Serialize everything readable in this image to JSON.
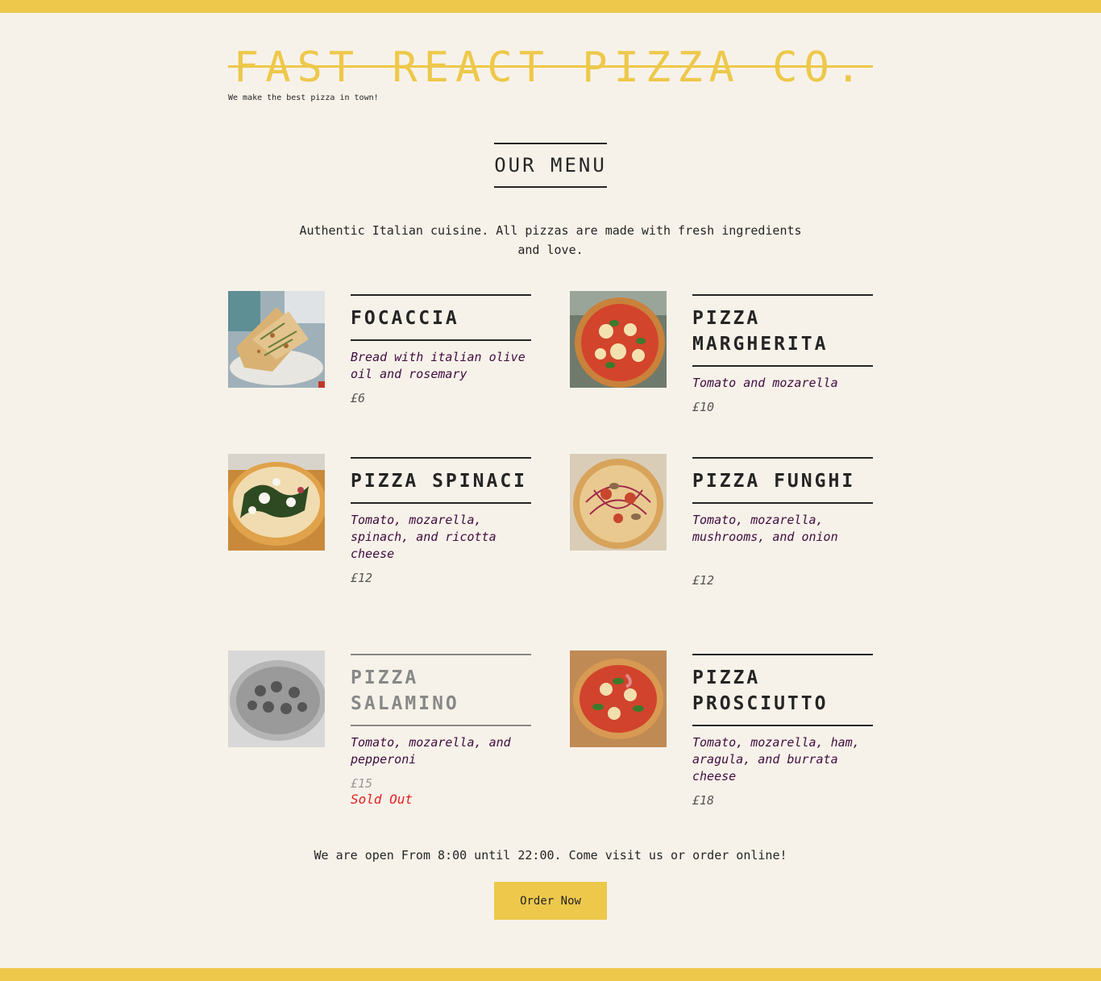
{
  "header": {
    "title": "FAST REACT PIZZA CO.",
    "tagline": "We make the best pizza in town!"
  },
  "menu": {
    "heading": "OUR MENU",
    "intro": "Authentic Italian cuisine. All pizzas are made with fresh ingredients and love.",
    "items": [
      {
        "name": "FOCACCIA",
        "description": "Bread with italian olive oil and rosemary",
        "price": "£6",
        "sold_out": false,
        "image": "focaccia-photo"
      },
      {
        "name": "PIZZA MARGHERITA",
        "description": "Tomato and mozarella",
        "price": "£10",
        "sold_out": false,
        "image": "margherita-photo"
      },
      {
        "name": "PIZZA SPINACI",
        "description": "Tomato, mozarella, spinach, and ricotta cheese",
        "price": "£12",
        "sold_out": false,
        "image": "spinaci-photo"
      },
      {
        "name": "PIZZA FUNGHI",
        "description": "Tomato, mozarella, mushrooms, and onion",
        "price": "£12",
        "sold_out": false,
        "image": "funghi-photo"
      },
      {
        "name": "PIZZA SALAMINO",
        "description": "Tomato, mozarella, and pepperoni",
        "price": "£15",
        "sold_out": true,
        "sold_out_label": "Sold Out",
        "image": "salamino-photo"
      },
      {
        "name": "PIZZA PROSCIUTTO",
        "description": "Tomato, mozarella, ham, aragula, and burrata cheese",
        "price": "£18",
        "sold_out": false,
        "image": "prosciutto-photo"
      }
    ]
  },
  "footer": {
    "text": "We are open From 8:00 until 22:00. Come visit us or order online!",
    "button_label": "Order Now"
  },
  "colors": {
    "accent": "#edc84b",
    "background": "#f7f2e9",
    "text": "#252525",
    "description": "#3f0b3f",
    "sold_out": "#e02020"
  }
}
